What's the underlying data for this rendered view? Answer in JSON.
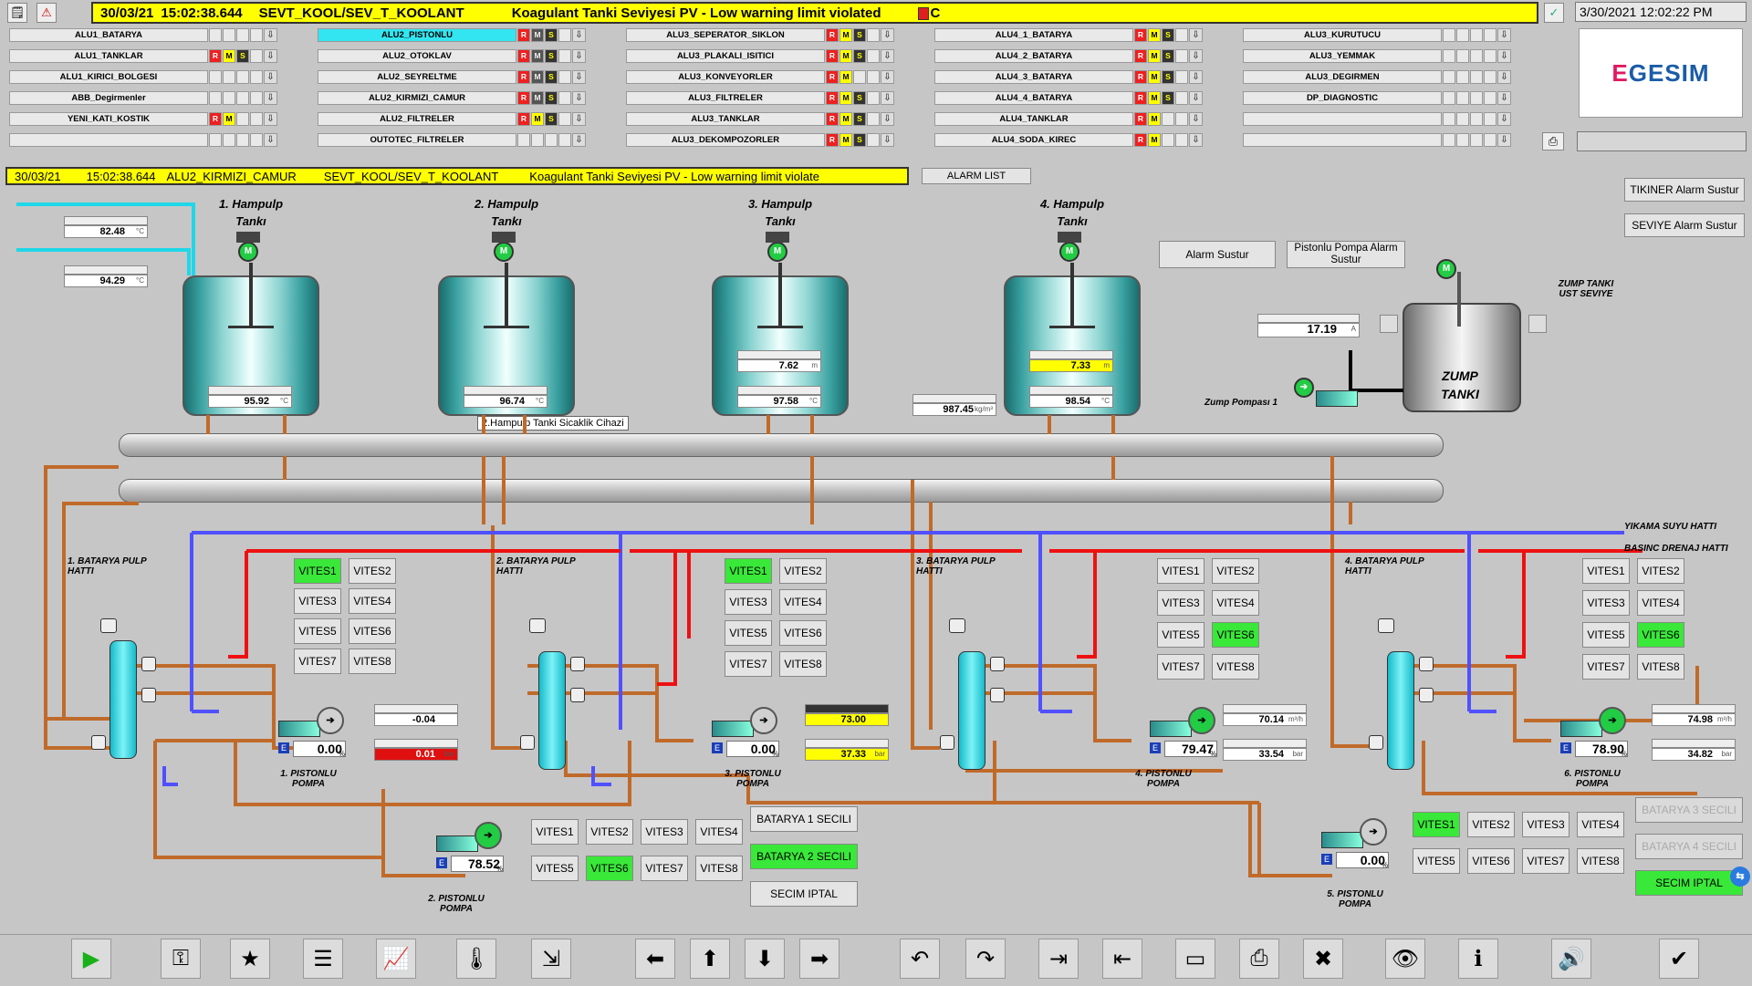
{
  "top_alarm": {
    "date": "30/03/21",
    "time": "15:02:38.644",
    "tag": "SEVT_KOOL/SEV_T_KOOLANT",
    "message": "Koagulant Tanki Seviyesi PV - Low warning limit violated",
    "suffix": "C"
  },
  "clock": "3/30/2021 12:02:22 PM",
  "logo": {
    "e": "E",
    "rest": "GESIM"
  },
  "areas": [
    [
      {
        "name": "ALU1_BATARYA",
        "ind": [
          "",
          "",
          "",
          ""
        ]
      },
      {
        "name": "ALU1_TANKLAR",
        "ind": [
          "R",
          "M",
          "S",
          ""
        ]
      },
      {
        "name": "ALU1_KIRICI_BOLGESI",
        "ind": [
          "",
          "",
          "",
          ""
        ]
      },
      {
        "name": "ABB_Degirmenler",
        "ind": [
          "",
          "",
          "",
          ""
        ]
      },
      {
        "name": "YENI_KATI_KOSTIK",
        "ind": [
          "R",
          "M",
          "",
          ""
        ]
      },
      {
        "name": "",
        "ind": [
          "",
          "",
          "",
          ""
        ]
      }
    ],
    [
      {
        "name": "ALU2_PISTONLU",
        "ind": [
          "R",
          "Mg",
          "S",
          ""
        ],
        "sel": true
      },
      {
        "name": "ALU2_OTOKLAV",
        "ind": [
          "R",
          "Mg",
          "S",
          ""
        ]
      },
      {
        "name": "ALU2_SEYRELTME",
        "ind": [
          "R",
          "Mg",
          "S",
          ""
        ]
      },
      {
        "name": "ALU2_KIRMIZI_CAMUR",
        "ind": [
          "R",
          "Mg",
          "S",
          ""
        ]
      },
      {
        "name": "ALU2_FILTRELER",
        "ind": [
          "R",
          "M",
          "S",
          ""
        ]
      },
      {
        "name": "OUTOTEC_FILTRELER",
        "ind": [
          "",
          "",
          "",
          ""
        ]
      }
    ],
    [
      {
        "name": "ALU3_SEPERATOR_SIKLON",
        "ind": [
          "R",
          "M",
          "S",
          ""
        ]
      },
      {
        "name": "ALU3_PLAKALI_ISITICI",
        "ind": [
          "R",
          "M",
          "S",
          ""
        ]
      },
      {
        "name": "ALU3_KONVEYORLER",
        "ind": [
          "R",
          "M",
          "",
          ""
        ]
      },
      {
        "name": "ALU3_FILTRELER",
        "ind": [
          "R",
          "M",
          "S",
          ""
        ]
      },
      {
        "name": "ALU3_TANKLAR",
        "ind": [
          "R",
          "M",
          "S",
          ""
        ]
      },
      {
        "name": "ALU3_DEKOMPOZORLER",
        "ind": [
          "R",
          "M",
          "S",
          ""
        ]
      }
    ],
    [
      {
        "name": "ALU4_1_BATARYA",
        "ind": [
          "R",
          "M",
          "S",
          ""
        ]
      },
      {
        "name": "ALU4_2_BATARYA",
        "ind": [
          "R",
          "M",
          "S",
          ""
        ]
      },
      {
        "name": "ALU4_3_BATARYA",
        "ind": [
          "R",
          "M",
          "S",
          ""
        ]
      },
      {
        "name": "ALU4_4_BATARYA",
        "ind": [
          "R",
          "M",
          "S",
          ""
        ]
      },
      {
        "name": "ALU4_TANKLAR",
        "ind": [
          "R",
          "M",
          "",
          ""
        ]
      },
      {
        "name": "ALU4_SODA_KIREC",
        "ind": [
          "R",
          "M",
          "",
          ""
        ]
      }
    ],
    [
      {
        "name": "ALU3_KURUTUCU",
        "ind": [
          "",
          "",
          "",
          ""
        ]
      },
      {
        "name": "ALU3_YEMMAK",
        "ind": [
          "",
          "",
          "",
          ""
        ]
      },
      {
        "name": "ALU3_DEGIRMEN",
        "ind": [
          "",
          "",
          "",
          ""
        ]
      },
      {
        "name": "DP_DIAGNOSTIC",
        "ind": [
          "",
          "",
          "",
          ""
        ]
      },
      {
        "name": "",
        "ind": [
          "",
          "",
          "",
          ""
        ]
      },
      {
        "name": "",
        "ind": [
          "",
          "",
          "",
          ""
        ]
      }
    ]
  ],
  "alarm2": {
    "date": "30/03/21",
    "time": "15:02:38.644",
    "area": "ALU2_KIRMIZI_CAMUR",
    "tag": "SEVT_KOOL/SEV_T_KOOLANT",
    "message": "Koagulant Tanki Seviyesi PV - Low warning limit violate"
  },
  "buttons": {
    "alarm_list": "ALARM LIST",
    "tikiner": "TIKINER Alarm Sustur",
    "seviye": "SEVIYE Alarm Sustur",
    "alarm_sustur": "Alarm Sustur",
    "pistonlu_sustur": "Pistonlu Pompa Alarm Sustur",
    "batarya1": "BATARYA 1 SECILI",
    "batarya2": "BATARYA 2 SECILI",
    "secim_iptal": "SECIM IPTAL",
    "batarya3": "BATARYA 3 SECILI",
    "batarya4": "BATARYA 4 SECILI",
    "secim_iptal2": "SECIM IPTAL"
  },
  "inlet_temps": [
    {
      "value": "82.48",
      "unit": "°C"
    },
    {
      "value": "94.29",
      "unit": "°C"
    }
  ],
  "tanks": [
    {
      "title": "1. Hampulp",
      "sub": "Tankı",
      "temp": "95.92",
      "unit": "°C"
    },
    {
      "title": "2. Hampulp",
      "sub": "Tankı",
      "temp": "96.74",
      "unit": "°C",
      "tooltip": "2.Hampulp Tanki Sicaklik Cihazi"
    },
    {
      "title": "3. Hampulp",
      "sub": "Tankı",
      "level": "7.62",
      "level_unit": "m",
      "temp": "97.58",
      "unit": "°C"
    },
    {
      "title": "4. Hampulp",
      "sub": "Tankı",
      "level": "7.33",
      "level_unit": "m",
      "temp": "98.54",
      "unit": "°C"
    }
  ],
  "pressure_mid": {
    "value": "987.45",
    "unit": "kg/m³"
  },
  "zump": {
    "title": "ZUMP TANKI",
    "title2": "TANKI",
    "title1": "ZUMP",
    "level_label": "ZUMP TANKI UST SEVIYE",
    "current": "17.19",
    "current_unit": "A",
    "pump_label": "Zump Pompası 1"
  },
  "lines": {
    "yikama": "YIKAMA SUYU HATTI",
    "basinc": "BASINC DRENAJ HATTI"
  },
  "batteries": [
    {
      "label": "1. BATARYA PULP HATTI"
    },
    {
      "label": "2. BATARYA PULP HATTI"
    },
    {
      "label": "3. BATARYA PULP HATTI"
    },
    {
      "label": "4. BATARYA PULP HATTI"
    }
  ],
  "vites_labels": [
    "VITES1",
    "VITES2",
    "VITES3",
    "VITES4",
    "VITES5",
    "VITES6",
    "VITES7",
    "VITES8"
  ],
  "pumps": [
    {
      "name": "1. PISTONLU POMPA",
      "value": "0.00",
      "unit": "%",
      "m1": "-0.04",
      "m1u": "",
      "m2": "0.01",
      "m2u": "bar"
    },
    {
      "name": "2. PISTONLU POMPA",
      "value": "78.52",
      "unit": "%"
    },
    {
      "name": "3. PISTONLU POMPA",
      "value": "0.00",
      "unit": "%",
      "m1": "73.00",
      "m1u": "",
      "m2": "37.33",
      "m2u": "bar"
    },
    {
      "name": "4. PISTONLU POMPA",
      "value": "79.47",
      "unit": "%",
      "m1": "70.14",
      "m1u": "m³/h",
      "m2": "33.54",
      "m2u": "bar"
    },
    {
      "name": "5. PISTONLU POMPA",
      "value": "0.00",
      "unit": "%"
    },
    {
      "name": "6. PISTONLU POMPA",
      "value": "78.90",
      "unit": "%",
      "m1": "74.98",
      "m1u": "m³/h",
      "m2": "34.82",
      "m2u": "bar"
    }
  ],
  "colors": {
    "accent_yellow": "#ffff00",
    "green": "#39e839",
    "pipe": "#c06a2a",
    "red_line": "#ee1111",
    "blue_line": "#5050ff"
  },
  "toolbar_icons": [
    "play-icon",
    "key-icon",
    "star-note-icon",
    "report-icon",
    "trend-icon",
    "thermo-icon",
    "export-icon",
    "arrow-left-icon",
    "arrow-up-icon",
    "arrow-down-icon",
    "arrow-right-icon",
    "undo-icon",
    "redo-icon",
    "monitor-enter-icon",
    "monitor-exit-icon",
    "window-icon",
    "print-icon",
    "close-window-icon",
    "screen-eye-icon",
    "info-icon",
    "sound-icon",
    "check-all-icon"
  ]
}
